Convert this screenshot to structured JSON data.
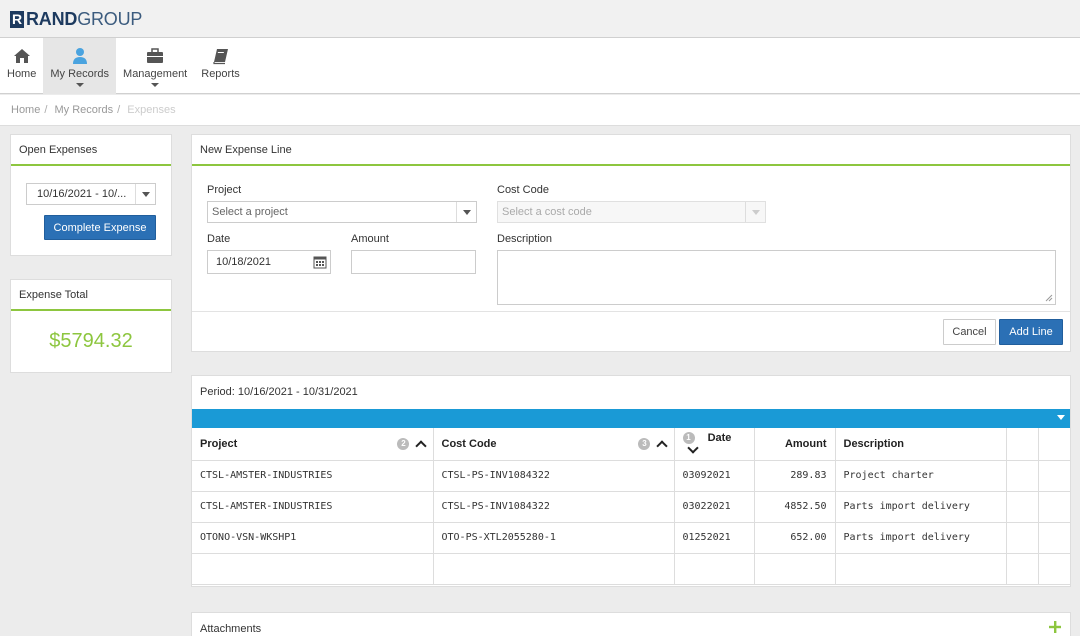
{
  "brand": {
    "mark": "R",
    "name_bold": "RAND",
    "name_light": "GROUP"
  },
  "nav": [
    {
      "label": "Home",
      "icon": "home-icon",
      "active": false
    },
    {
      "label": "My Records",
      "icon": "user-icon",
      "active": true
    },
    {
      "label": "Management",
      "icon": "briefcase-icon",
      "active": false
    },
    {
      "label": "Reports",
      "icon": "book-icon",
      "active": false
    }
  ],
  "breadcrumb": {
    "home": "Home",
    "records": "My Records",
    "current": "Expenses"
  },
  "open_expenses": {
    "title": "Open Expenses",
    "period_select": "10/16/2021 - 10/...",
    "complete_button": "Complete Expense"
  },
  "expense_total": {
    "title": "Expense Total",
    "value": "$5794.32",
    "color": "#8dc63f"
  },
  "new_line": {
    "title": "New Expense Line",
    "project_label": "Project",
    "project_placeholder": "Select a project",
    "cost_code_label": "Cost Code",
    "cost_code_placeholder": "Select a cost code",
    "date_label": "Date",
    "date_value": "10/18/2021",
    "amount_label": "Amount",
    "amount_value": "",
    "description_label": "Description",
    "description_value": "",
    "cancel_button": "Cancel",
    "add_button": "Add Line"
  },
  "lines": {
    "period": "Period: 10/16/2021 - 10/31/2021",
    "header_bar_color": "#1a9ad6",
    "columns": {
      "project": "Project",
      "project_sort": "2",
      "cost_code": "Cost Code",
      "cost_code_sort": "3",
      "date": "Date",
      "date_sort": "1",
      "amount": "Amount",
      "description": "Description"
    },
    "rows": [
      {
        "project": "CTSL-AMSTER-INDUSTRIES",
        "cost_code": "CTSL-PS-INV1084322",
        "date": "03092021",
        "amount": "289.83",
        "description": "Project charter"
      },
      {
        "project": "CTSL-AMSTER-INDUSTRIES",
        "cost_code": "CTSL-PS-INV1084322",
        "date": "03022021",
        "amount": "4852.50",
        "description": "Parts import delivery"
      },
      {
        "project": "OTONO-VSN-WKSHP1",
        "cost_code": "OTO-PS-XTL2055280-1",
        "date": "01252021",
        "amount": "652.00",
        "description": "Parts import delivery"
      }
    ]
  },
  "attachments": {
    "title": "Attachments",
    "add_icon": "plus-icon"
  },
  "colors": {
    "accent_green": "#8dc63f",
    "primary_blue": "#2b70b5",
    "table_bar": "#1a9ad6"
  }
}
